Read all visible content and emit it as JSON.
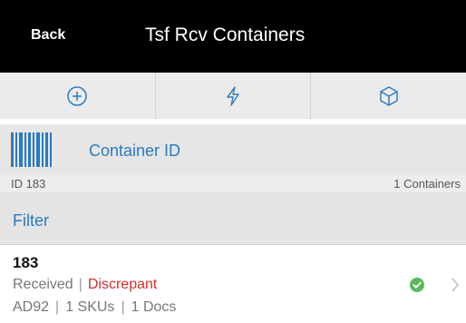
{
  "header": {
    "back_label": "Back",
    "title": "Tsf Rcv Containers"
  },
  "toolbar": {
    "items": [
      {
        "icon": "add-circle-icon"
      },
      {
        "icon": "lightning-icon"
      },
      {
        "icon": "box-icon"
      }
    ]
  },
  "scan": {
    "icon": "barcode-icon",
    "label": "Container ID"
  },
  "summary": {
    "id_text": "ID 183",
    "count_text": "1 Containers"
  },
  "filter": {
    "label": "Filter"
  },
  "containers": [
    {
      "id": "183",
      "status": "Received",
      "discrepancy": "Discrepant",
      "code": "AD92",
      "skus": "1 SKUs",
      "docs": "1 Docs",
      "check_color": "#5cb85c"
    }
  ],
  "colors": {
    "accent": "#2a7bbf",
    "discrepant": "#d0312d",
    "header_bg": "#000000"
  }
}
